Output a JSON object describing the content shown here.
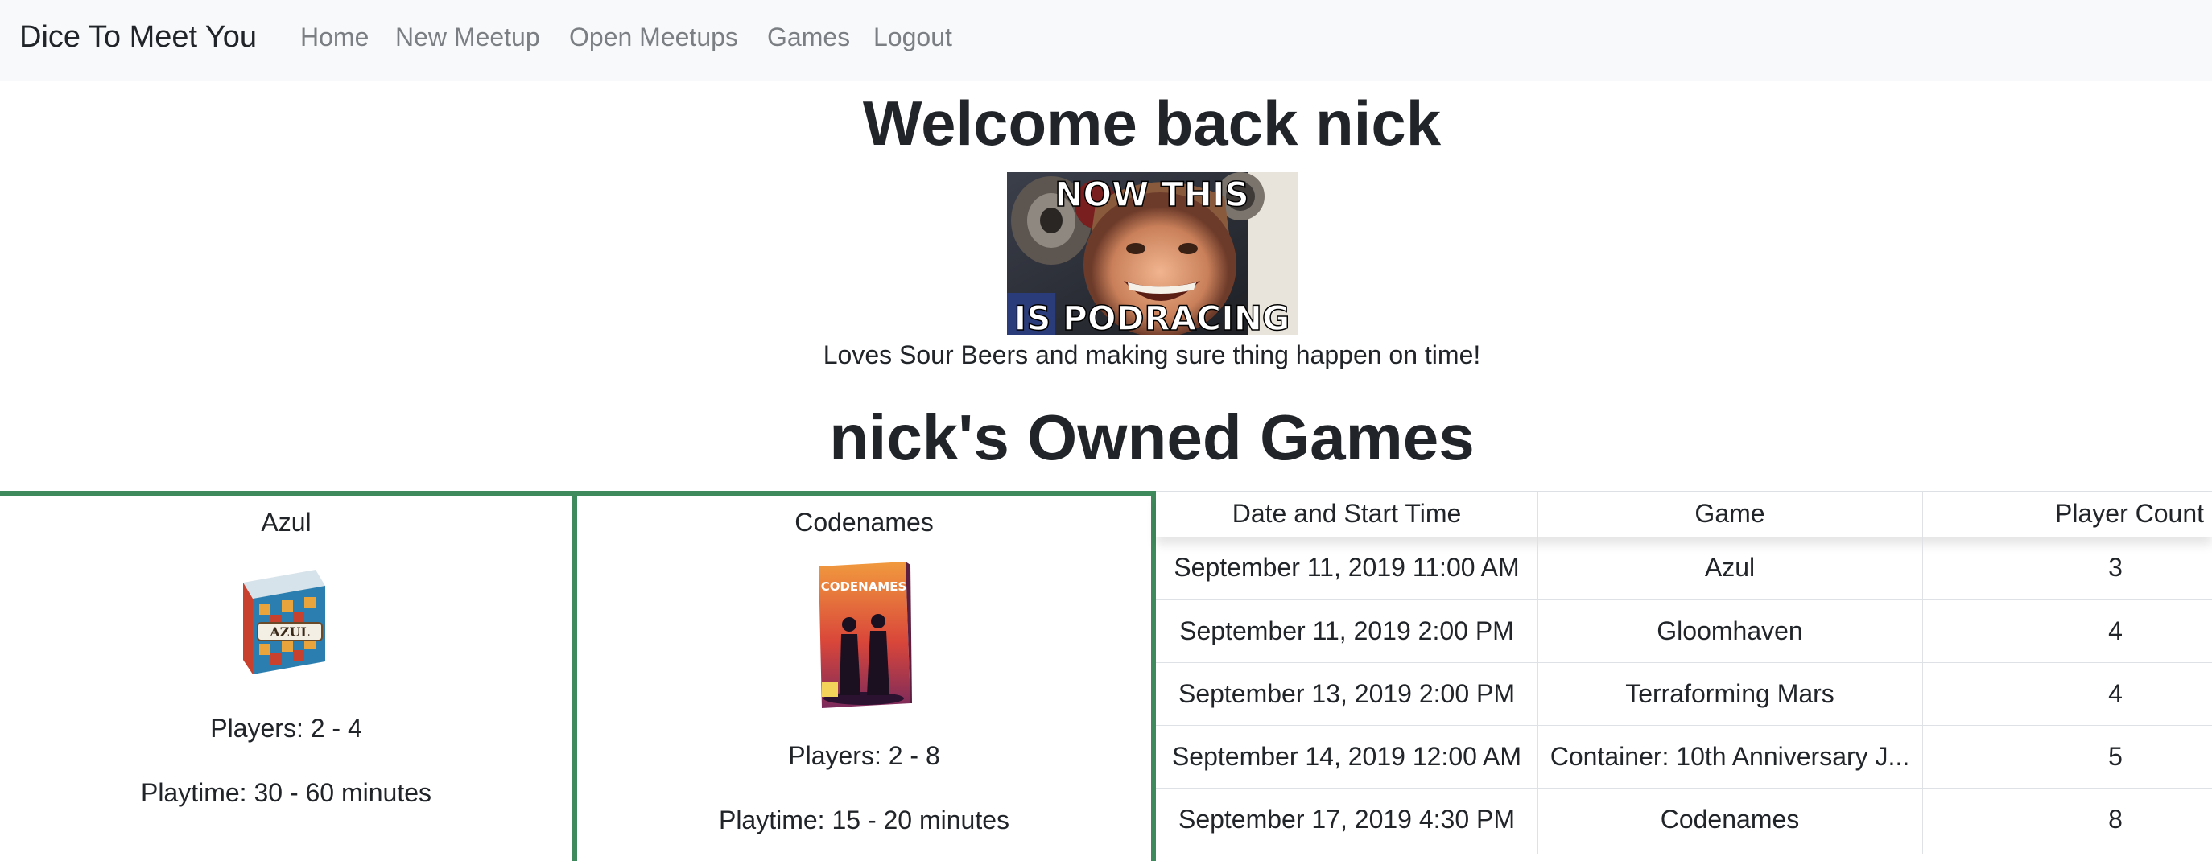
{
  "nav": {
    "brand": "Dice To Meet You",
    "links": [
      "Home",
      "New Meetup",
      "Open Meetups",
      "Games",
      "Logout"
    ]
  },
  "profile": {
    "welcome": "Welcome back nick",
    "meme_top": "NOW THIS",
    "meme_bottom": "IS PODRACING",
    "bio": "Loves Sour Beers and making sure thing happen on time!",
    "owned_title": "nick's Owned Games"
  },
  "games": [
    {
      "name": "Azul",
      "box_label": "AZUL",
      "players": "Players: 2 - 4",
      "playtime": "Playtime: 30 - 60 minutes"
    },
    {
      "name": "Codenames",
      "box_label": "CODENAMES",
      "players": "Players: 2 - 8",
      "playtime": "Playtime: 15 - 20 minutes"
    }
  ],
  "meetups": {
    "headers": [
      "Date and Start Time",
      "Game",
      "Player Count"
    ],
    "rows": [
      [
        "September 11, 2019 11:00 AM",
        "Azul",
        "3"
      ],
      [
        "September 11, 2019 2:00 PM",
        "Gloomhaven",
        "4"
      ],
      [
        "September 13, 2019 2:00 PM",
        "Terraforming Mars",
        "4"
      ],
      [
        "September 14, 2019 12:00 AM",
        "Container: 10th Anniversary J...",
        "5"
      ],
      [
        "September 17, 2019 4:30 PM",
        "Codenames",
        "8"
      ]
    ]
  },
  "colors": {
    "accent_border": "#3f8a5c",
    "navbar_bg": "#f8f9fa",
    "nav_link": "#7b7f83"
  }
}
